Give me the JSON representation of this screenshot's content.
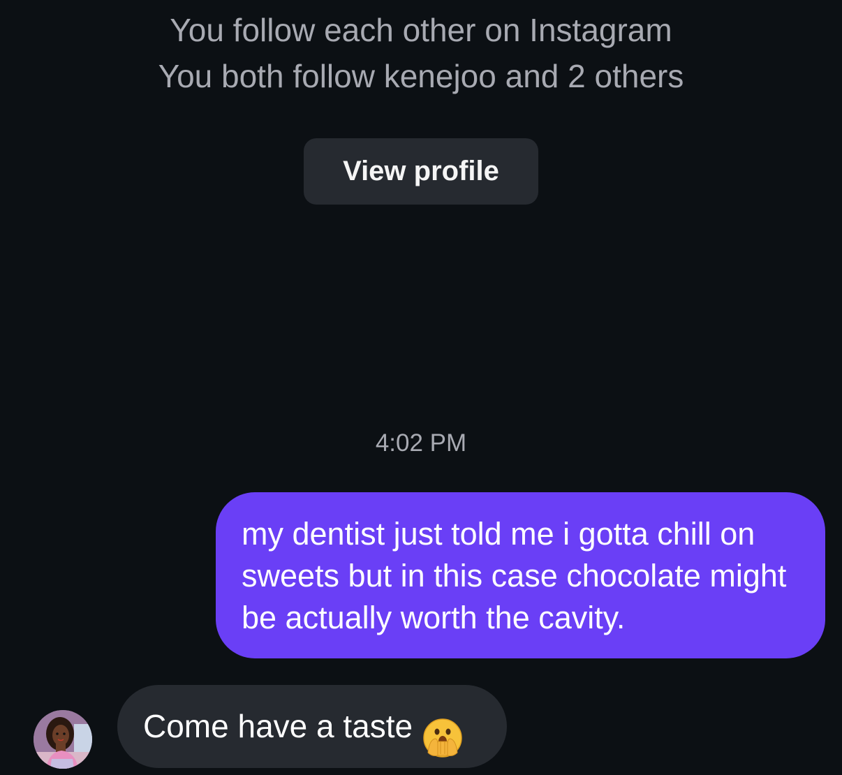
{
  "profile": {
    "follow_status": "You follow each other on Instagram",
    "mutual_follows": "You both follow kenejoo and 2 others",
    "view_profile_label": "View profile"
  },
  "thread": {
    "timestamp": "4:02 PM",
    "messages": [
      {
        "direction": "outgoing",
        "text": "my dentist just told me i gotta chill on sweets but in this case chocolate might be actually worth the cavity."
      },
      {
        "direction": "incoming",
        "text": "Come have a taste",
        "emoji": "face-with-open-eyes-and-hand-over-mouth-icon"
      }
    ]
  },
  "colors": {
    "background": "#0c1014",
    "outgoing_bubble": "#6a3ff6",
    "incoming_bubble": "#262a30",
    "secondary_text": "#a8aab2"
  }
}
